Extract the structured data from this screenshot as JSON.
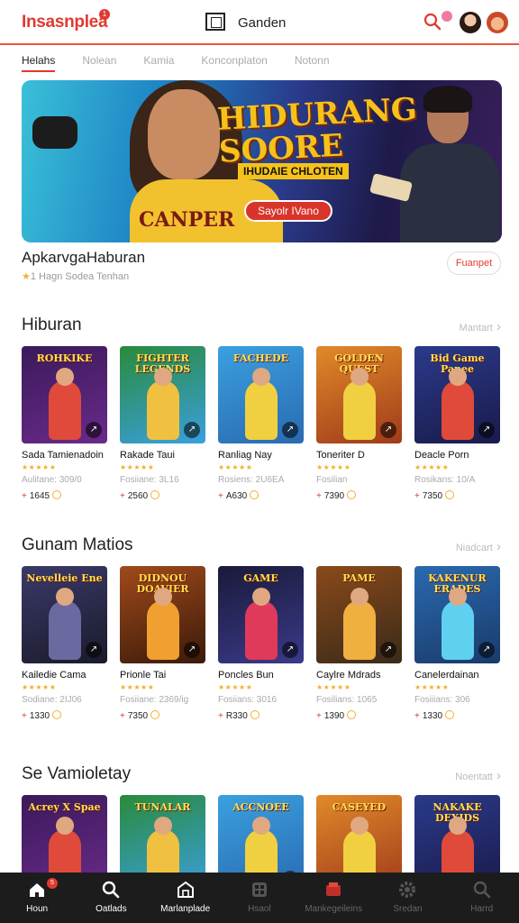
{
  "header": {
    "logo": "Insasnplea",
    "logo_badge": "1",
    "center_title": "Ganden",
    "icons": [
      "search-icon",
      "avatar",
      "avatar"
    ]
  },
  "tabs": [
    "Helahs",
    "Nolean",
    "Kamia",
    "Konconplaton",
    "Notonn"
  ],
  "hero": {
    "title_line1": "HIDURANG",
    "title_line2": "SOORE",
    "subtitle": "IHUDAIE CHLOTEN",
    "shirt_text": "CANPER",
    "cta": "Sayolr IVano"
  },
  "promo": {
    "title": "ApkarvgaHaburan",
    "meta": "1 Hagn Sodea Tenhan",
    "button": "Fuanpet"
  },
  "sections": [
    {
      "title": "Hiburan",
      "more": "Mantart",
      "items": [
        {
          "art": "ROHKIKE",
          "name": "Sada Tamienadoin",
          "sub": "Aulitane: 309/0",
          "price": "1645"
        },
        {
          "art": "FIGHTER LEGENDS",
          "name": "Rakade Taui",
          "sub": "Fosiiane: 3L16",
          "price": "2560"
        },
        {
          "art": "FACHEDE",
          "name": "Ranliag Nay",
          "sub": "Rosiens: 2U6EA",
          "price": "A630"
        },
        {
          "art": "GOLDEN QUEST",
          "name": "Toneriter D",
          "sub": "Fosilian",
          "price": "7390"
        },
        {
          "art": "Bid Game Panee",
          "name": "Deacle Porn",
          "sub": "Rosikans: 10/A",
          "price": "7350"
        }
      ]
    },
    {
      "title": "Gunam Matios",
      "more": "Niadcart",
      "items": [
        {
          "art": "Nevelleie Ene",
          "name": "Kailedie Cama",
          "sub": "Sodiane: 2IJ06",
          "price": "1330"
        },
        {
          "art": "DIDNOU DOAVIER",
          "name": "Prionle Tai",
          "sub": "Fosiiane: 2369/ig",
          "price": "7350"
        },
        {
          "art": "GAME",
          "name": "Poncles Bun",
          "sub": "Fosiians: 3016",
          "price": "R330"
        },
        {
          "art": "PAME",
          "name": "Caylre Mdrads",
          "sub": "Fosilians: 1065",
          "price": "1390"
        },
        {
          "art": "KAKENUR ERADES",
          "name": "Canelerdainan",
          "sub": "Fosiiians: 306",
          "price": "1330"
        }
      ]
    },
    {
      "title": "Se Vamioletay",
      "more": "Noentatt",
      "items": [
        {
          "art": "Acrey X Spae",
          "name": "",
          "sub": "",
          "price": ""
        },
        {
          "art": "TUNALAR",
          "name": "",
          "sub": "",
          "price": ""
        },
        {
          "art": "ACCNOEE",
          "name": "",
          "sub": "",
          "price": ""
        },
        {
          "art": "CASEYED",
          "name": "",
          "sub": "",
          "price": ""
        },
        {
          "art": "NAKAKE DEXIDS",
          "name": "",
          "sub": "",
          "price": ""
        }
      ]
    }
  ],
  "bottom_nav": [
    {
      "label": "Houn",
      "icon": "home-icon",
      "badge": "5"
    },
    {
      "label": "Oatlads",
      "icon": "search-icon"
    },
    {
      "label": "Marlanplade",
      "icon": "store-icon"
    },
    {
      "label": "Hsaol",
      "icon": "grid-icon"
    },
    {
      "label": "Mankegeileins",
      "icon": "deals-icon"
    },
    {
      "label": "Sredan",
      "icon": "gear-icon"
    },
    {
      "label": "Harrd",
      "icon": "search-icon"
    }
  ],
  "colors": {
    "accent": "#e03a2f",
    "star": "#f0b030",
    "nav_bg": "#1c1c1c"
  }
}
